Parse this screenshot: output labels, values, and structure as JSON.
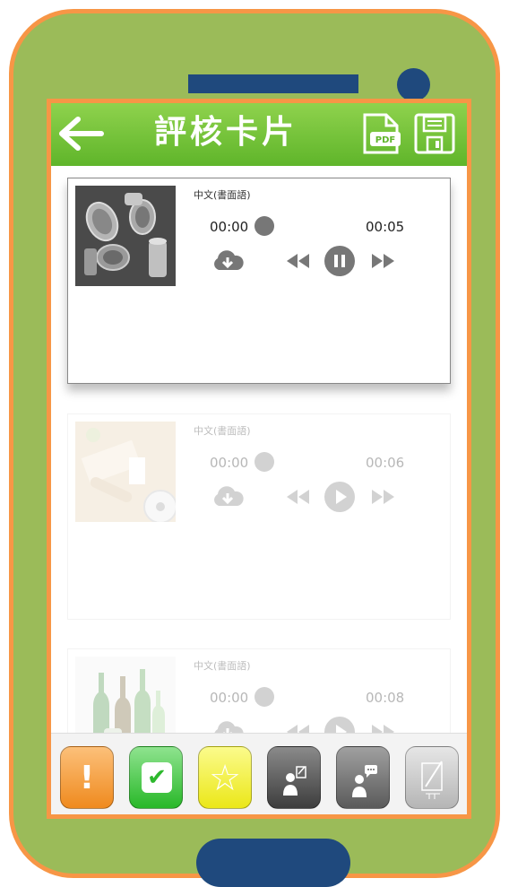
{
  "header": {
    "title": "評核卡片",
    "back_icon": "arrow-left-icon",
    "pdf_icon": "pdf-icon",
    "pdf_label": "PDF",
    "save_icon": "save-icon"
  },
  "cards": [
    {
      "language": "中文(書面語)",
      "time_current": "00:00",
      "time_total": "00:05",
      "state": "playing",
      "image": "tin-cans-photo"
    },
    {
      "language": "中文(書面語)",
      "time_current": "00:00",
      "time_total": "00:06",
      "state": "paused",
      "image": "paper-rolls-photo"
    },
    {
      "language": "中文(書面語)",
      "time_current": "00:00",
      "time_total": "00:08",
      "state": "paused",
      "image": "glass-bottles-photo"
    }
  ],
  "toolbar": [
    {
      "name": "warning-button",
      "icon": "exclamation-icon",
      "symbol": "!",
      "color": "#f39b2e"
    },
    {
      "name": "correct-button",
      "icon": "check-icon",
      "symbol": "✔",
      "color": "#3cbf3c"
    },
    {
      "name": "star-button",
      "icon": "star-person-icon",
      "symbol": "☆",
      "color": "#f1ef2c"
    },
    {
      "name": "teacher-note-button",
      "icon": "person-note-icon",
      "symbol": "",
      "color": "#555555"
    },
    {
      "name": "speech-button",
      "icon": "person-speech-icon",
      "symbol": "",
      "color": "#6e6e6e"
    },
    {
      "name": "sign-button",
      "icon": "pen-sign-icon",
      "symbol": "",
      "color": "#c8c8c8"
    }
  ]
}
